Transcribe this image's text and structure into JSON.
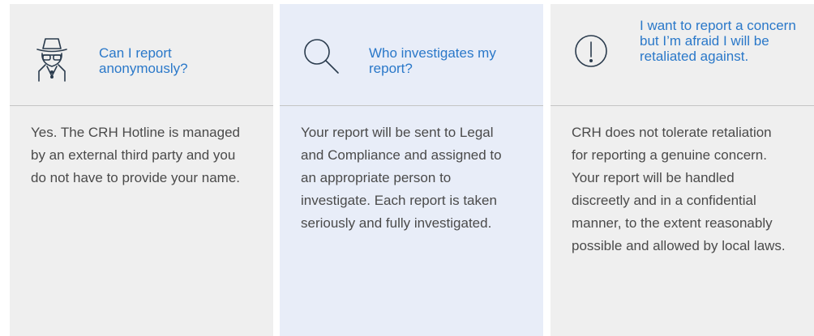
{
  "faq": [
    {
      "icon": "incognito-spy-icon",
      "question": "Can I report anonymously?",
      "answer": "Yes. The CRH Hotline is managed by an external third party and you do not have to provide your name."
    },
    {
      "icon": "magnifier-icon",
      "question": "Who investigates my report?",
      "answer": "Your report will be sent to Legal and Compliance and assigned to an appropriate person to investigate. Each report is taken seriously and fully investigated."
    },
    {
      "icon": "exclamation-circle-icon",
      "question": "I want to report a concern but I’m afraid I will be retaliated against.",
      "answer": "CRH does not tolerate retaliation for reporting a genuine concern. Your report will be handled discreetly and in a confidential manner, to the extent reasonably possible and allowed by local laws."
    }
  ],
  "colors": {
    "accent": "#2a78c9",
    "card_background": "#efefef",
    "highlight_background": "#e8edf8",
    "body_text": "#4a4a4a",
    "divider": "#c4c4c4"
  }
}
